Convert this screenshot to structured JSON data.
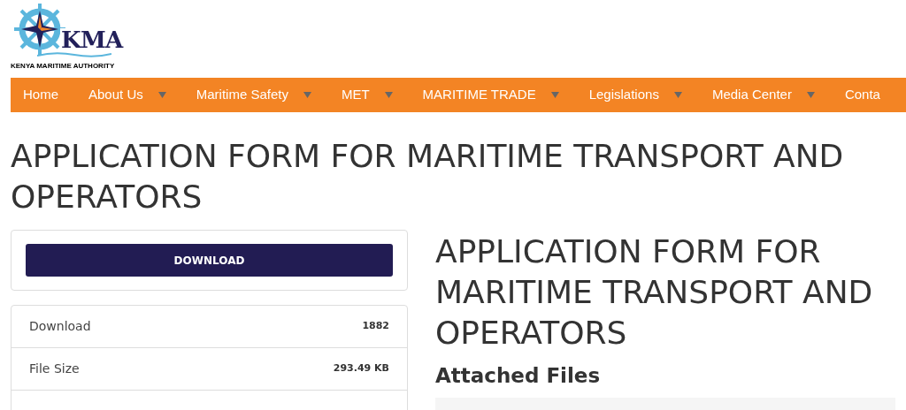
{
  "logo": {
    "mark": "KMA",
    "caption": "KENYA MARITIME AUTHORITY"
  },
  "nav": [
    {
      "label": "Home",
      "has_dropdown": false
    },
    {
      "label": "About Us",
      "has_dropdown": true
    },
    {
      "label": "Maritime Safety",
      "has_dropdown": true
    },
    {
      "label": "MET",
      "has_dropdown": true
    },
    {
      "label": "MARITIME TRADE",
      "has_dropdown": true
    },
    {
      "label": "Legislations",
      "has_dropdown": true
    },
    {
      "label": "Media Center",
      "has_dropdown": true
    },
    {
      "label": "Conta",
      "has_dropdown": false
    }
  ],
  "page_title": "APPLICATION FORM FOR MARITIME TRANSPORT AND OPERATORS",
  "download_button": "DOWNLOAD",
  "details": [
    {
      "label": "Download",
      "value": "1882"
    },
    {
      "label": "File Size",
      "value": "293.49 KB"
    }
  ],
  "content": {
    "title": "APPLICATION FORM FOR MARITIME TRANSPORT AND OPERATORS",
    "section": "Attached Files"
  }
}
